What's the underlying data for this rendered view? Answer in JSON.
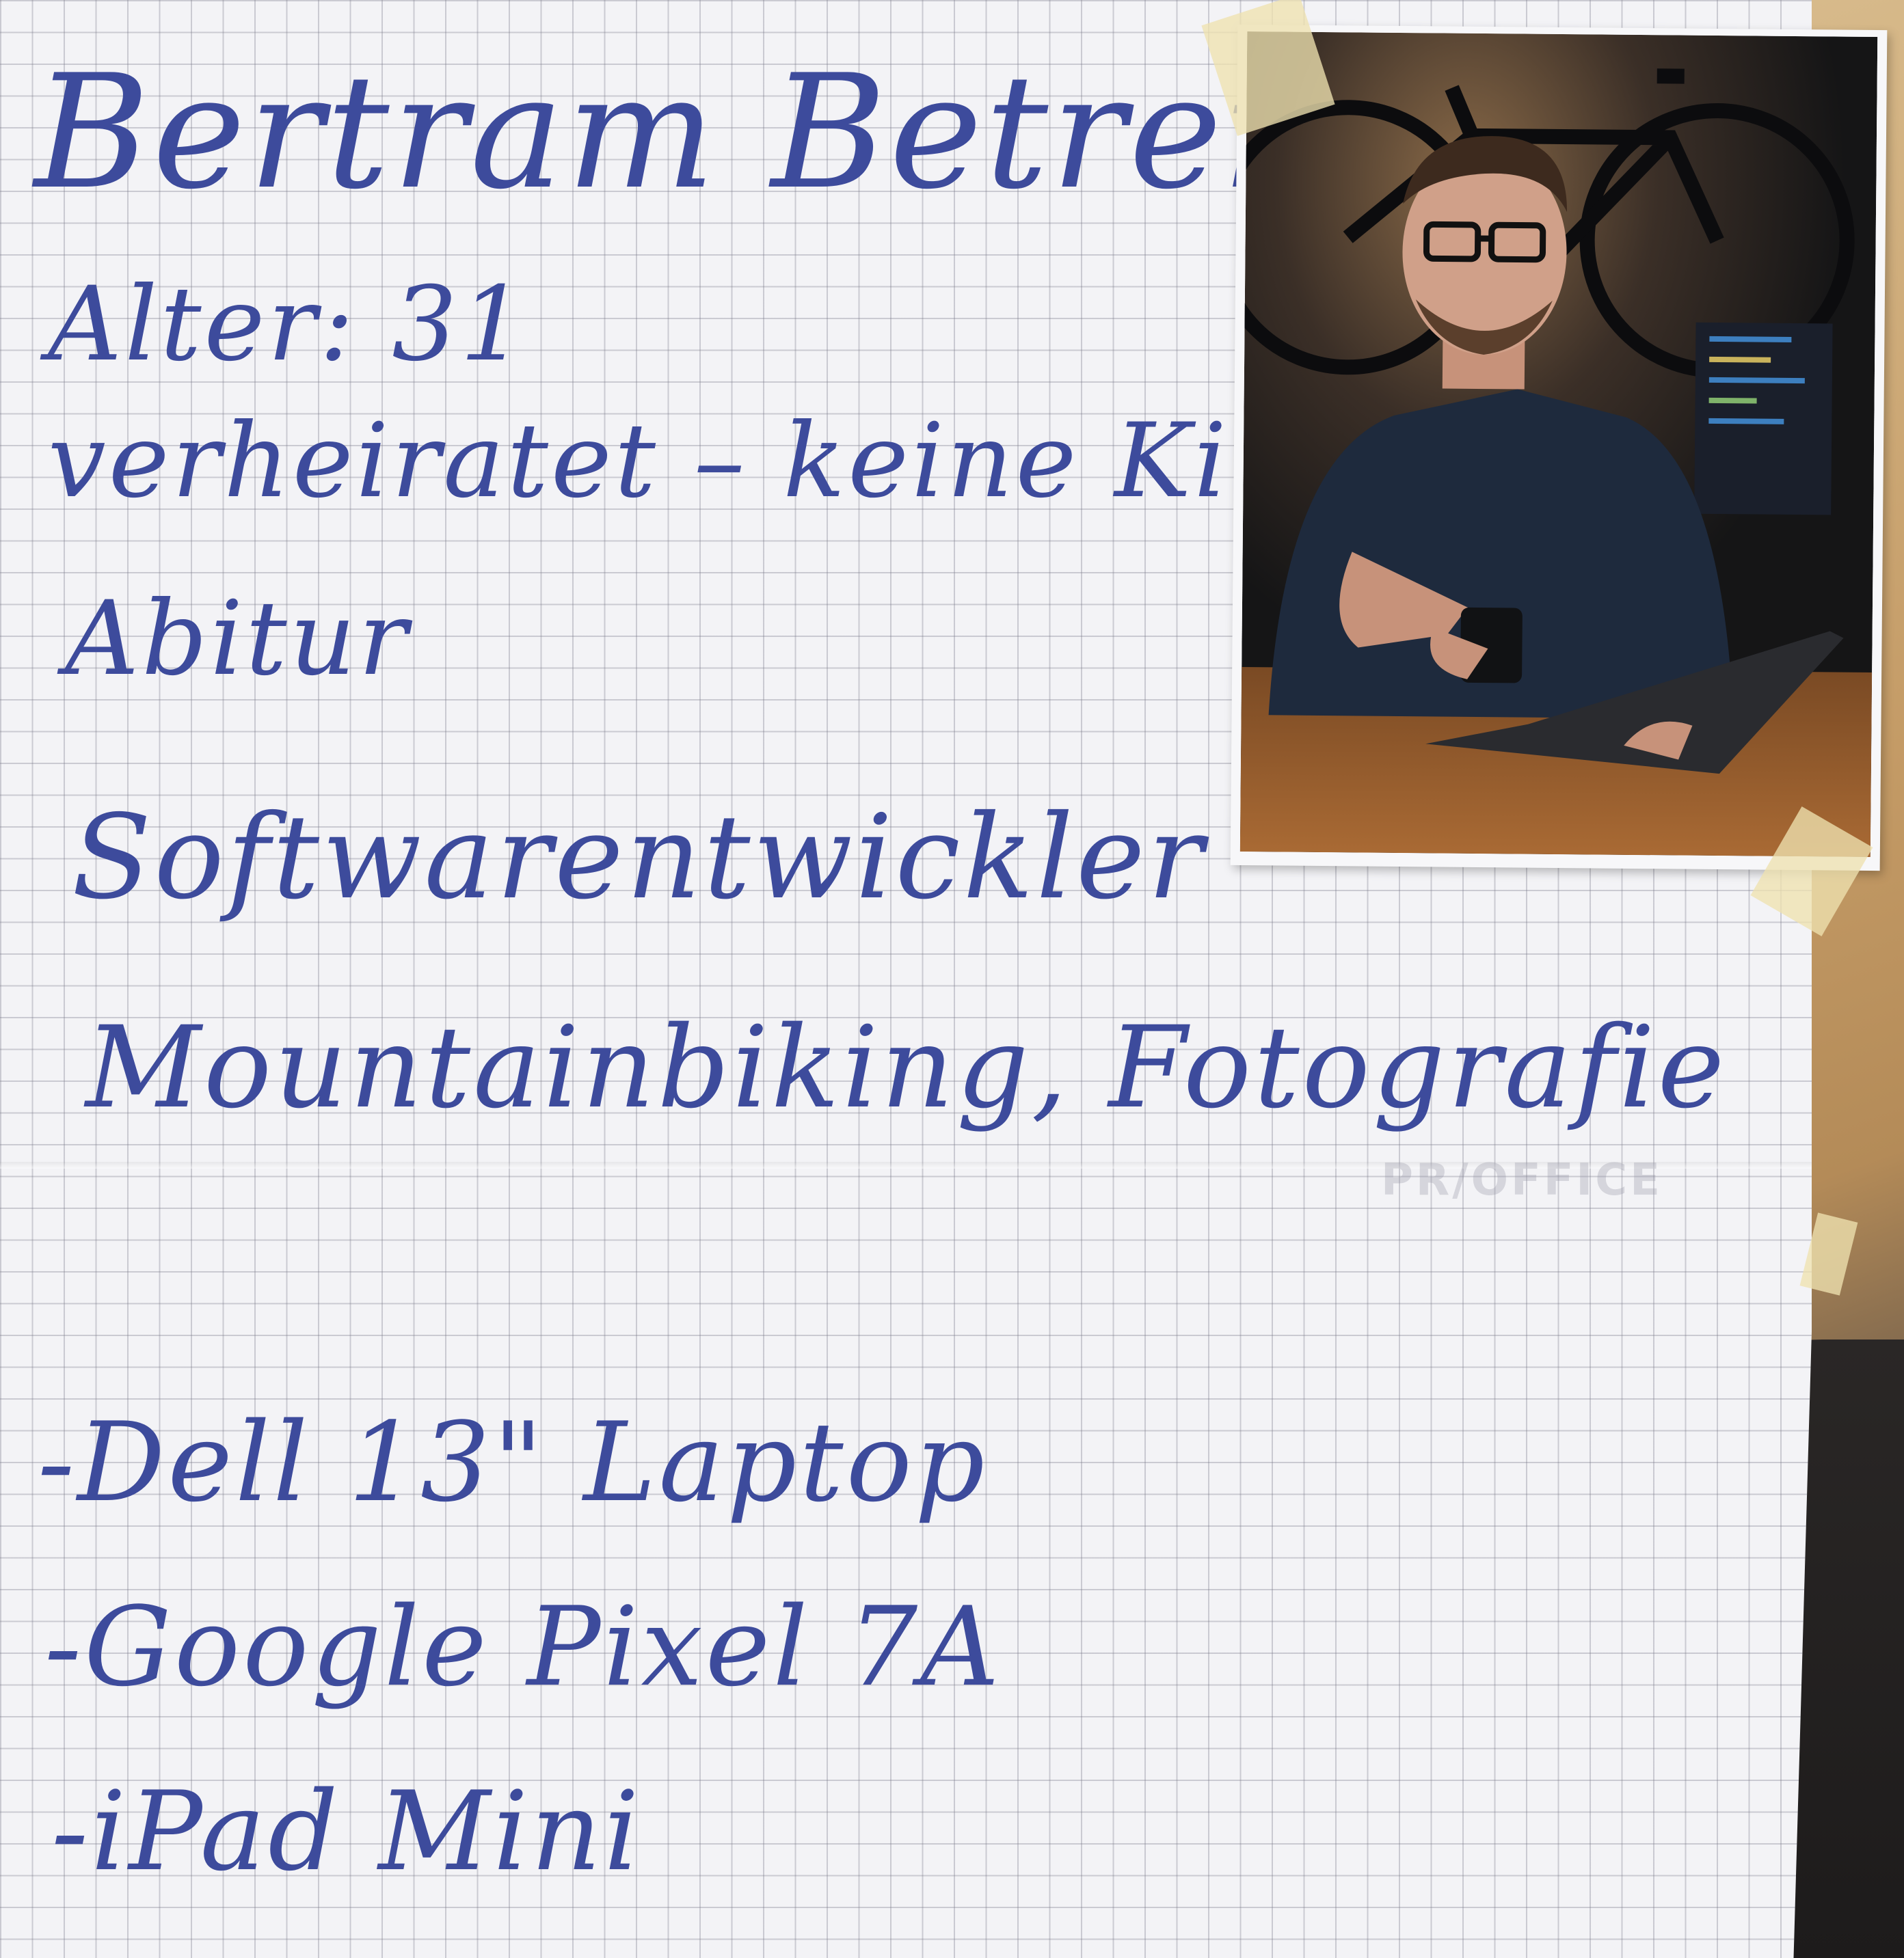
{
  "poster": {
    "name": "Bertram Betreiber",
    "age_line": "Alter: 31",
    "family_line": "verheiratet – keine Kinder",
    "education": "Abitur",
    "job": "Softwarentwickler",
    "hobbies": "Mountainbiking, Fotografie",
    "devices": [
      "-Dell 13\" Laptop",
      "-Google Pixel 7A",
      "-iPad Mini"
    ]
  },
  "paper_brand": "PR/OFFICE",
  "photo": {
    "subject": "portrait-photo",
    "scene": "man with glasses at desk with laptop and mug, bicycle on wall"
  },
  "colors": {
    "ink": "#3d4b9c",
    "paper": "#f3f3f6",
    "grid": "#9a9aa8"
  }
}
